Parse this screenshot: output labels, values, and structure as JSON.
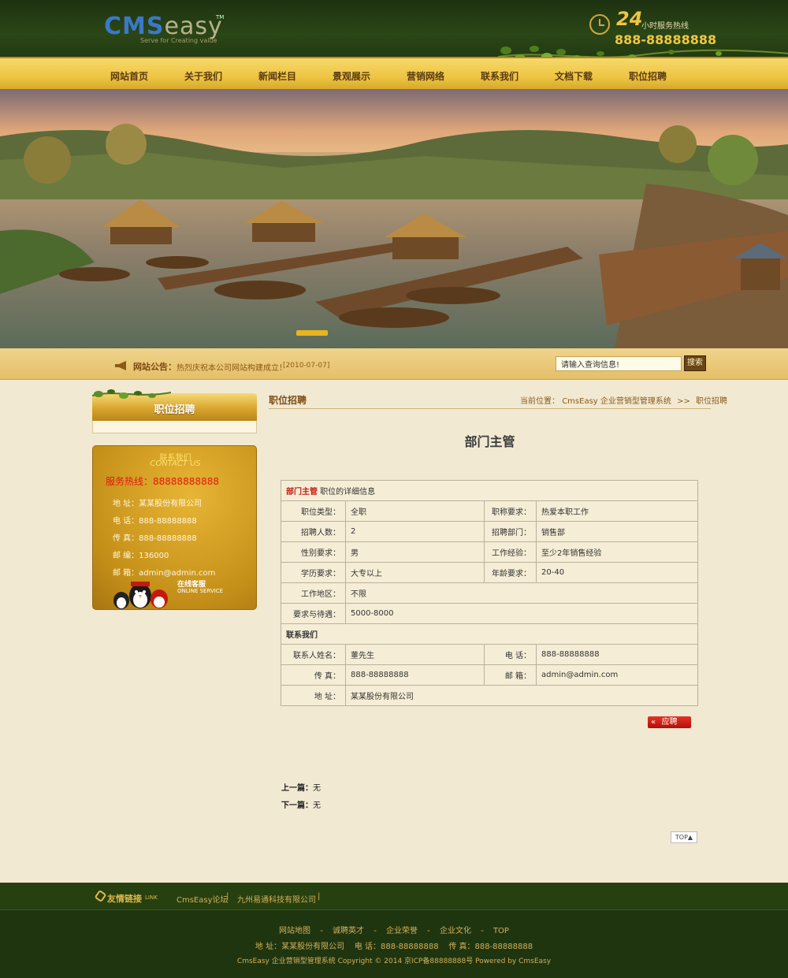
{
  "header": {
    "logo_cms": "CMS",
    "logo_easy": "easy",
    "logo_tm": "TM",
    "logo_slogan": "Serve for Creating value",
    "hotline_24": "24",
    "hotline_label": "小时服务热线",
    "hotline_phone": "888-88888888"
  },
  "nav": {
    "items": [
      "网站首页",
      "关于我们",
      "新闻栏目",
      "景观展示",
      "营销网络",
      "联系我们",
      "文档下载",
      "职位招聘"
    ]
  },
  "notice": {
    "label": "网站公告：",
    "text": "热烈庆祝本公司网站构建成立！",
    "date": "[2010-07-07]"
  },
  "search": {
    "placeholder": "请输入查询信息!",
    "button": "搜索"
  },
  "sidebar": {
    "title": "职位招聘",
    "contact": {
      "title": "联系我们",
      "title_en": "CONTACT US",
      "hotline": "服务热线：88888888888",
      "address": "地 址：某某股份有限公司",
      "phone": "电 话：888-88888888",
      "fax": "传 真：888-88888888",
      "zip": "邮 编：136000",
      "email": "邮 箱：admin@admin.com",
      "online": "在线客服",
      "online_en": "ONLINE SERVICE"
    }
  },
  "main": {
    "section_title": "职位招聘",
    "breadcrumb": {
      "prefix": "当前位置：",
      "site": "CmsEasy 企业营销型管理系统",
      "sep": ">>",
      "current": "职位招聘"
    },
    "job_title": "部门主管",
    "table": {
      "head_job": "部门主管",
      "head_desc": "职位的详细信息",
      "rows": [
        [
          "职位类型：",
          "全职",
          "职称要求：",
          "热爱本职工作"
        ],
        [
          "招聘人数：",
          "2",
          "招聘部门：",
          "销售部"
        ],
        [
          "性别要求：",
          "男",
          "工作经验：",
          "至少2年销售经验"
        ],
        [
          "学历要求：",
          "大专以上",
          "年龄要求：",
          "20-40"
        ]
      ],
      "area_label": "工作地区：",
      "area": "不限",
      "salary_label": "要求与待遇：",
      "salary": "5000-8000",
      "contact_head": "联系我们",
      "contact_rows": [
        [
          "联系人姓名：",
          "董先生",
          "电 话：",
          "888-88888888"
        ],
        [
          "传 真：",
          "888-88888888",
          "邮 箱：",
          "admin@admin.com"
        ]
      ],
      "address_label": "地 址：",
      "address": "某某股份有限公司"
    },
    "apply_button": "应聘",
    "prev_label": "上一篇：",
    "prev_value": "无",
    "next_label": "下一篇：",
    "next_value": "无",
    "top_button": "TOP▲"
  },
  "footer": {
    "links_label": "友情链接",
    "links_label_en": "LINK",
    "links": [
      "CmsEasy论坛",
      "九州易通科技有限公司"
    ],
    "link_sep": "|",
    "nav": [
      "网站地图",
      "诚聘英才",
      "企业荣誉",
      "企业文化",
      "TOP"
    ],
    "nav_sep": "-",
    "address": "地 址：某某股份有限公司",
    "phone": "电 话：888-88888888",
    "fax": "传 真：888-88888888",
    "copyright": "CmsEasy 企业营销型管理系统 Copyright © 2014 京ICP备88888888号 Powered by CmsEasy"
  },
  "colors": {
    "header_bg": "#2b4617",
    "nav_bg": "#eec544",
    "page_bg": "#f2e9d2",
    "accent_red": "#c41a0e",
    "gold": "#f0c640"
  }
}
